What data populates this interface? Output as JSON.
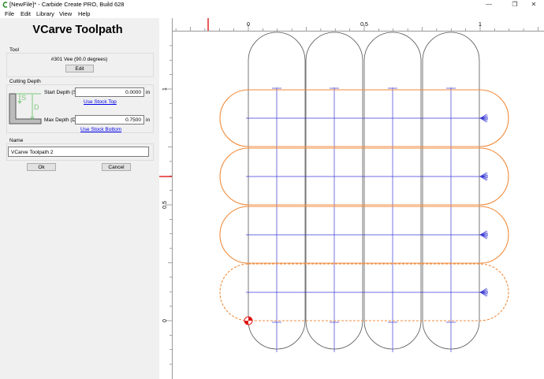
{
  "window": {
    "title": "[NewFile]* - Carbide Create PRO, Build 628",
    "minimize_glyph": "—",
    "maximize_glyph": "❐",
    "close_glyph": "✕"
  },
  "menu": {
    "items": [
      "File",
      "Edit",
      "Library",
      "View",
      "Help"
    ]
  },
  "panel": {
    "heading": "VCarve Toolpath",
    "tool": {
      "group_label": "Tool",
      "name": "#301 Vee (90.0 degrees)",
      "edit_label": "Edit"
    },
    "cutting_depth": {
      "group_label": "Cutting Depth",
      "diagram_s": "S",
      "diagram_d": "D",
      "start_label": "Start Depth (S)",
      "start_value": "0.0000",
      "start_unit": "in",
      "use_stock_top": "Use Stock Top",
      "max_label": "Max Depth (D)",
      "max_value": "0.7500",
      "max_unit": "in",
      "use_stock_bottom": "Use Stock Bottom"
    },
    "name": {
      "group_label": "Name",
      "value": "VCarve Toolpath 2"
    },
    "ok_label": "Ok",
    "cancel_label": "Cancel"
  },
  "canvas": {
    "ruler_top_labels": [
      "0",
      "0.5",
      "1"
    ],
    "ruler_left_labels": [
      "1",
      "0.5",
      "0"
    ],
    "colors": {
      "outline": "#555555",
      "selected": "#f08b3c",
      "toolpath": "#3b3bd6",
      "marker": "#e01818"
    }
  }
}
